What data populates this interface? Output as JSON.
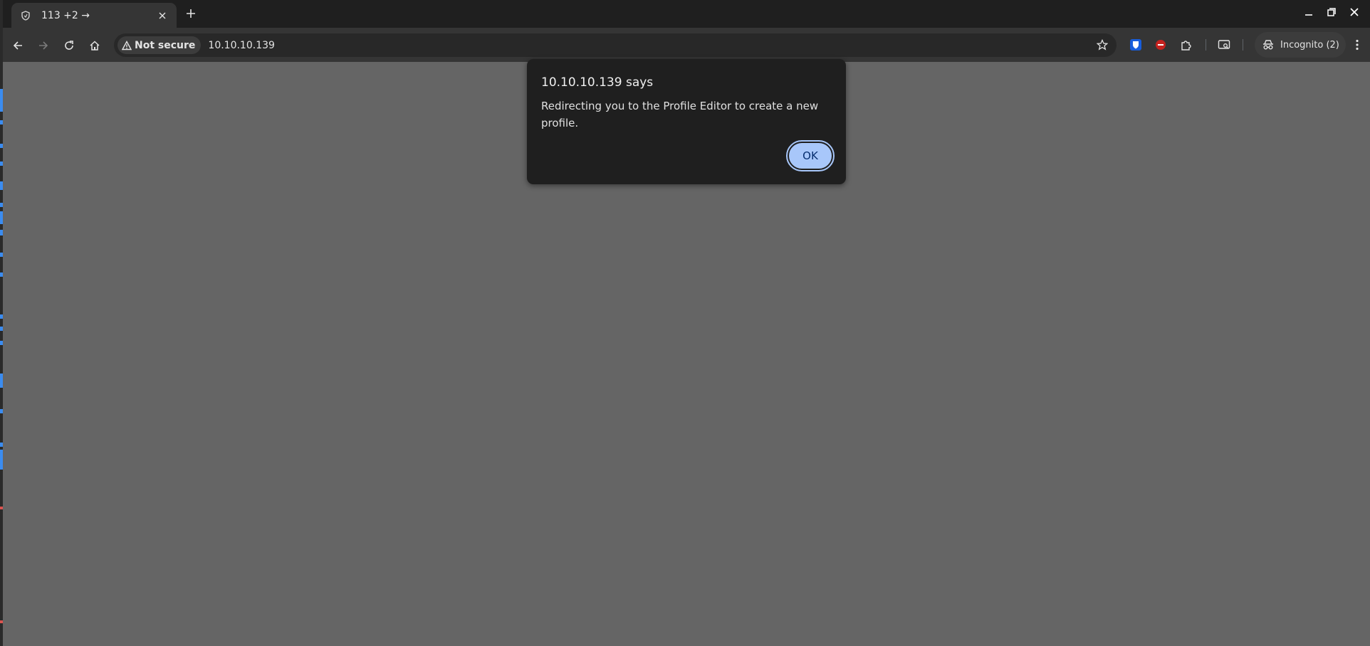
{
  "browser": {
    "tab": {
      "title": "113 +2 →"
    },
    "address_bar": {
      "security_label": "Not secure",
      "url": "10.10.10.139"
    },
    "profile": {
      "label": "Incognito (2)"
    },
    "colors": {
      "accent": "#a8c7fa",
      "page_bg": "#656565",
      "dialog_bg": "#1f1f1f"
    }
  },
  "dialog": {
    "title": "10.10.10.139 says",
    "message": "Redirecting you to the Profile Editor to create a new profile.",
    "ok_label": "OK"
  }
}
